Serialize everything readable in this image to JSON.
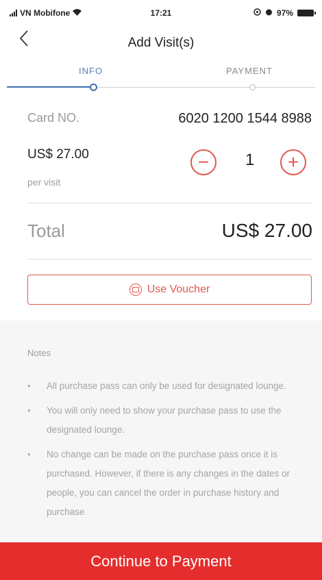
{
  "status": {
    "carrier": "VN Mobifone",
    "time": "17:21",
    "battery": "97%"
  },
  "nav": {
    "back_icon": "chevron-left-icon",
    "title": "Add Visit(s)"
  },
  "steps": [
    {
      "label": "INFO",
      "active": true
    },
    {
      "label": "PAYMENT",
      "active": false
    }
  ],
  "card": {
    "label": "Card NO.",
    "number": "6020 1200 1544 8988"
  },
  "price": {
    "amount": "US$ 27.00",
    "unit": "per visit"
  },
  "quantity": {
    "minus": "−",
    "value": "1",
    "plus": "+"
  },
  "total": {
    "label": "Total",
    "amount": "US$ 27.00"
  },
  "voucher": {
    "label": "Use Voucher",
    "icon": "voucher-icon"
  },
  "notes": {
    "title": "Notes",
    "items": [
      "All purchase pass can only be used for designated lounge.",
      "You will only need to show your purchase pass to use the designated lounge.",
      "No change can be made on the purchase pass once it is purchased. However, if there is any changes in the dates or people, you can cancel the order in purchase history and purchase"
    ]
  },
  "cta": {
    "label": "Continue to Payment"
  },
  "colors": {
    "accent": "#e0594f",
    "cta": "#e52d2d",
    "step_active": "#3e6fae"
  }
}
